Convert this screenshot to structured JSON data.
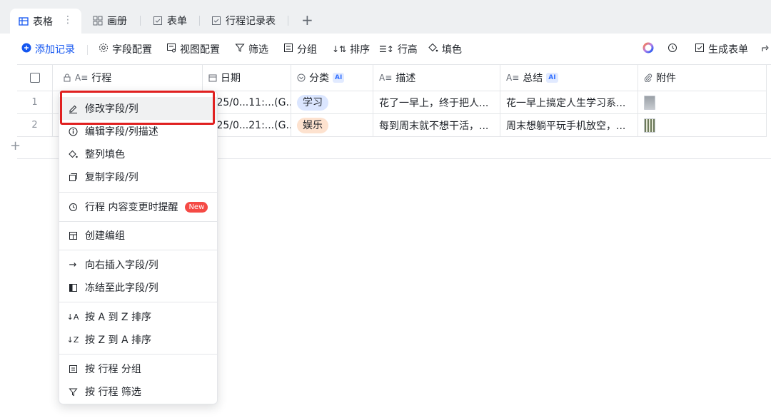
{
  "tabs": [
    {
      "label": "表格",
      "icon": "table-icon"
    },
    {
      "label": "画册",
      "icon": "gallery-icon"
    },
    {
      "label": "表单",
      "icon": "form-icon"
    },
    {
      "label": "行程记录表",
      "icon": "form-icon"
    }
  ],
  "tab_add": "+",
  "tab_more": "⋮",
  "toolbar": {
    "add_record": "添加记录",
    "field_config": "字段配置",
    "view_config": "视图配置",
    "filter": "筛选",
    "group": "分组",
    "sort": "排序",
    "row_height": "行高",
    "fill": "填色",
    "generate_form": "生成表单"
  },
  "columns": [
    {
      "label": "行程",
      "icon": "text-field-icon"
    },
    {
      "label": "日期",
      "icon": "calendar-icon"
    },
    {
      "label": "分类",
      "icon": "select-icon",
      "ai": "AI"
    },
    {
      "label": "描述",
      "icon": "text-field-icon"
    },
    {
      "label": "总结",
      "icon": "text-field-icon",
      "ai": "AI"
    },
    {
      "label": "附件",
      "icon": "attachment-icon"
    }
  ],
  "rows": [
    {
      "num": "1",
      "date": ")25/0...11:...(G...",
      "category": "学习",
      "desc": "花了一早上，终于把人...",
      "summary": "花一早上搞定人生学习系..."
    },
    {
      "num": "2",
      "date": ")25/0...21:...(G...",
      "category": "娱乐",
      "desc": "每到周末就不想干活，...",
      "summary": "周末想躺平玩手机放空，..."
    }
  ],
  "add_row": "+",
  "menu": {
    "items": [
      {
        "label": "修改字段/列",
        "icon": "edit-icon"
      },
      {
        "label": "编辑字段/列描述",
        "icon": "info-icon"
      },
      {
        "label": "整列填色",
        "icon": "paint-bucket-icon"
      },
      {
        "label": "复制字段/列",
        "icon": "copy-icon"
      },
      {
        "label": "行程 内容变更时提醒",
        "icon": "bell-icon",
        "badge": "New"
      },
      {
        "label": "创建编组",
        "icon": "group-icon"
      },
      {
        "label": "向右插入字段/列",
        "icon": "arrow-right-icon"
      },
      {
        "label": "冻结至此字段/列",
        "icon": "freeze-icon"
      },
      {
        "label": "按 A 到 Z 排序",
        "icon": "sort-asc-icon"
      },
      {
        "label": "按 Z 到 A 排序",
        "icon": "sort-desc-icon"
      },
      {
        "label": "按 行程 分组",
        "icon": "group-by-icon"
      },
      {
        "label": "按 行程 筛选",
        "icon": "filter-icon"
      }
    ]
  },
  "colors": {
    "accent": "#1456f0",
    "highlight_box": "#e02020",
    "new_badge": "#f54a45"
  }
}
